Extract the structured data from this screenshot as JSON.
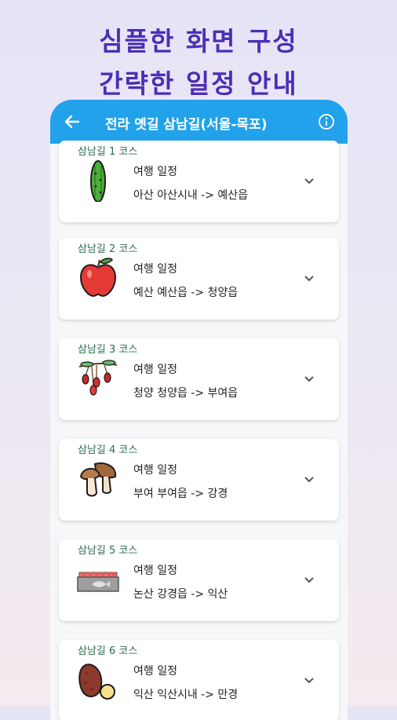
{
  "promo": {
    "line1": "심플한 화면 구성",
    "line2": "간략한 일정 안내"
  },
  "appbar": {
    "title": "전라 옛길 삼남길(서울-목포)",
    "back_icon": "arrow-left-icon",
    "info_icon": "info-icon"
  },
  "colors": {
    "accent": "#22a2ea",
    "headline": "#4b2fb4",
    "course_label": "#2e6c52"
  },
  "courses": [
    {
      "title": "삼남길 1 코스",
      "plan_label": "여행 일정",
      "route": "아산 아산시내 -> 예산읍",
      "icon": "cucumber-icon"
    },
    {
      "title": "삼남길 2 코스",
      "plan_label": "여행 일정",
      "route": "예산 예산읍 -> 청양읍",
      "icon": "apple-icon"
    },
    {
      "title": "삼남길 3 코스",
      "plan_label": "여행 일정",
      "route": "청양 청양읍 -> 부여읍",
      "icon": "goji-berry-icon"
    },
    {
      "title": "삼남길 4 코스",
      "plan_label": "여행 일정",
      "route": "부여 부여읍 -> 강경",
      "icon": "mushroom-icon"
    },
    {
      "title": "삼남길 5 코스",
      "plan_label": "여행 일정",
      "route": "논산 강경읍 -> 익산",
      "icon": "fish-crate-icon"
    },
    {
      "title": "삼남길 6 코스",
      "plan_label": "여행 일정",
      "route": "익산 익산시내 -> 만경",
      "icon": "sweet-potato-icon"
    }
  ]
}
